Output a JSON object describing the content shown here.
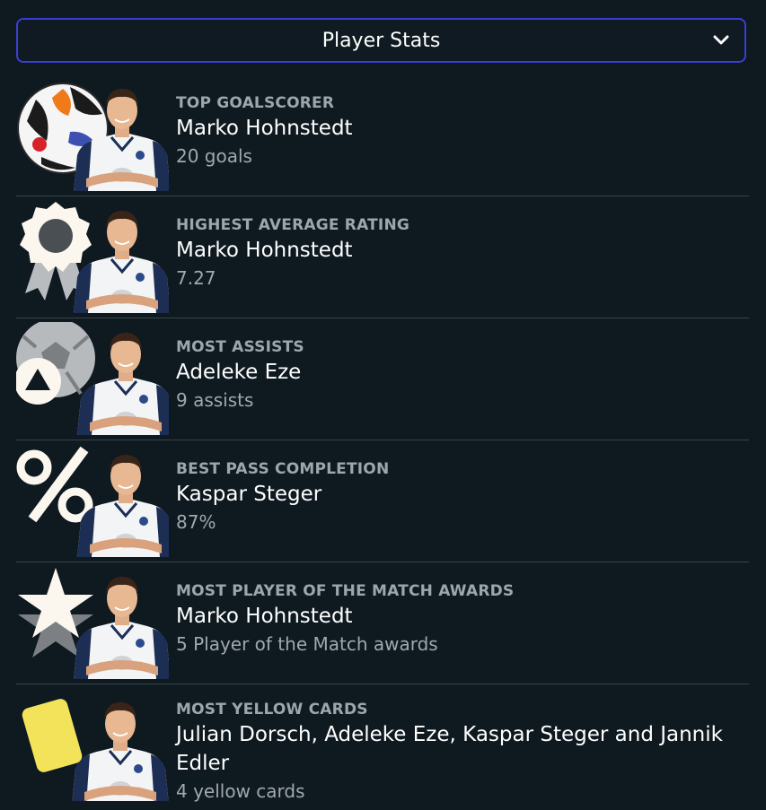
{
  "dropdown": {
    "label": "Player Stats",
    "icon": "chevron-down-icon"
  },
  "stats": [
    {
      "category": "TOP GOALSCORER",
      "name": "Marko Hohnstedt",
      "value": "20 goals",
      "icon": "football-icon"
    },
    {
      "category": "HIGHEST AVERAGE RATING",
      "name": "Marko Hohnstedt",
      "value": "7.27",
      "icon": "award-ribbon-icon"
    },
    {
      "category": "MOST ASSISTS",
      "name": "Adeleke Eze",
      "value": "9 assists",
      "icon": "assist-ball-icon"
    },
    {
      "category": "BEST PASS COMPLETION",
      "name": "Kaspar Steger",
      "value": "87%",
      "icon": "percent-icon"
    },
    {
      "category": "MOST PLAYER OF THE MATCH AWARDS",
      "name": "Marko Hohnstedt",
      "value": "5 Player of the Match awards",
      "icon": "star-icon"
    },
    {
      "category": "MOST YELLOW CARDS",
      "name": "Julian Dorsch, Adeleke Eze, Kaspar Steger and Jannik Edler",
      "value": "4 yellow cards",
      "icon": "yellow-card-icon"
    }
  ],
  "colors": {
    "background": "#0e1920",
    "dropdown_border": "#3a3fd0",
    "divider": "#3a4349",
    "category_text": "#9ea6ad",
    "yellow_card": "#f2e35a",
    "icon_fill": "#fbf6ee"
  }
}
